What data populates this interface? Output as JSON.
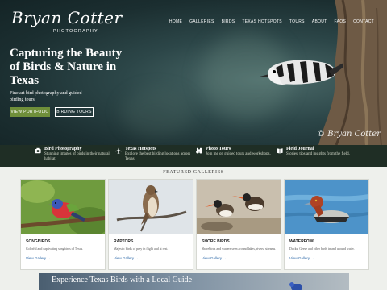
{
  "logo": {
    "script": "Bryan Cotter",
    "subtitle": "PHOTOGRAPHY"
  },
  "nav": {
    "items": [
      {
        "label": "HOME",
        "active": true
      },
      {
        "label": "GALLERIES"
      },
      {
        "label": "BIRDS"
      },
      {
        "label": "TEXAS HOTSPOTS"
      },
      {
        "label": "TOURS"
      },
      {
        "label": "ABOUT"
      },
      {
        "label": "FAQS"
      },
      {
        "label": "CONTACT"
      }
    ]
  },
  "hero": {
    "title": "Capturing the Beauty of Birds & Nature in Texas",
    "subtitle": "Fine art bird photography and guided birding tours.",
    "primary_button": "VIEW PORTFOLIO",
    "secondary_button": "BIRDING TOURS",
    "signature": "© Bryan Cotter"
  },
  "features": [
    {
      "icon": "camera-icon",
      "title": "Bird Photography",
      "text": "Stunning images of birds in their natural habitat."
    },
    {
      "icon": "airplane-icon",
      "title": "Texas Hotspots",
      "text": "Explore the best birding locations across Texas."
    },
    {
      "icon": "binoculars-icon",
      "title": "Photo Tours",
      "text": "Join me on guided tours and workshops."
    },
    {
      "icon": "book-icon",
      "title": "Field Journal",
      "text": "Stories, tips and insights from the field."
    }
  ],
  "galleries": {
    "title": "FEATURED GALLERIES",
    "cards": [
      {
        "title": "SONGBIRDS",
        "desc": "Colorful and captivating songbirds of Texas.",
        "link": "View Gallery →"
      },
      {
        "title": "RAPTORS",
        "desc": "Majestic birds of prey in flight and at rest.",
        "link": "View Gallery →"
      },
      {
        "title": "SHORE BIRDS",
        "desc": "Shorebirds and waders seen around lakes, rivers, streams.",
        "link": "View Gallery →"
      },
      {
        "title": "WATERFOWL",
        "desc": "Ducks, Geese and other birds in and around water.",
        "link": "View Gallery →"
      }
    ]
  },
  "banner": {
    "text": "Experience Texas Birds with a Local Guide"
  },
  "colors": {
    "accent": "#6f8f3a",
    "strip": "#1f2e25",
    "link": "#2f6aa9"
  }
}
